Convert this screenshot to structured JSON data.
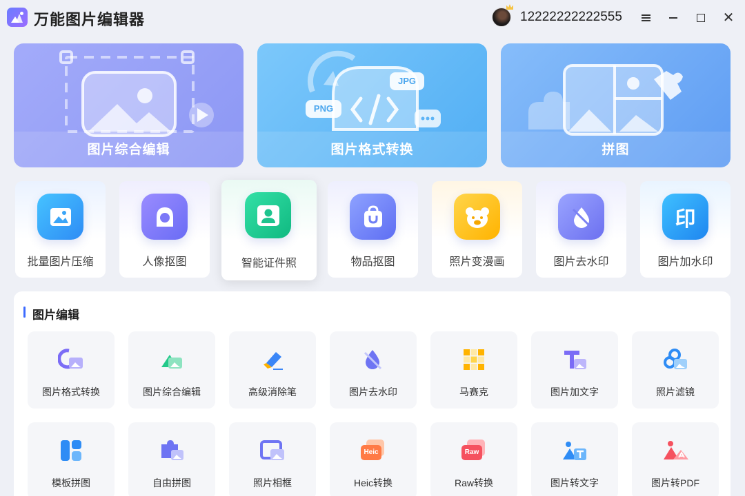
{
  "app": {
    "title": "万能图片编辑器",
    "username": "12222222222555"
  },
  "hero_cards": [
    {
      "label": "图片综合编辑",
      "color": "#8f9af8"
    },
    {
      "label": "图片格式转换",
      "color": "#63b9f8",
      "badges": [
        "PNG",
        "JPG"
      ]
    },
    {
      "label": "拼图",
      "color": "#6aa6f7"
    }
  ],
  "tools": [
    {
      "label": "批量图片压缩",
      "icon": "compress-icon"
    },
    {
      "label": "人像抠图",
      "icon": "portrait-icon"
    },
    {
      "label": "智能证件照",
      "icon": "id-photo-icon"
    },
    {
      "label": "物品抠图",
      "icon": "bag-icon"
    },
    {
      "label": "照片变漫画",
      "icon": "bear-icon"
    },
    {
      "label": "图片去水印",
      "icon": "drop-icon"
    },
    {
      "label": "图片加水印",
      "icon": "stamp-icon",
      "glyph": "印"
    }
  ],
  "section": {
    "title": "图片编辑",
    "items": [
      {
        "label": "图片格式转换"
      },
      {
        "label": "图片综合编辑"
      },
      {
        "label": "高级消除笔"
      },
      {
        "label": "图片去水印"
      },
      {
        "label": "马赛克"
      },
      {
        "label": "图片加文字"
      },
      {
        "label": "照片滤镜"
      },
      {
        "label": "模板拼图"
      },
      {
        "label": "自由拼图"
      },
      {
        "label": "照片相框"
      },
      {
        "label": "Heic转换",
        "badge": "Heic"
      },
      {
        "label": "Raw转换",
        "badge": "Raw"
      },
      {
        "label": "图片转文字"
      },
      {
        "label": "图片转PDF"
      }
    ]
  }
}
